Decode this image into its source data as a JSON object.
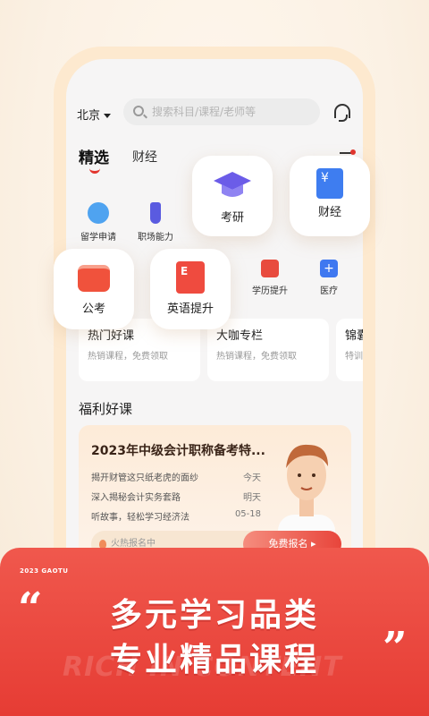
{
  "topbar": {
    "city": "北京",
    "search_placeholder": "搜索科目/课程/老师等"
  },
  "tabs": [
    "精选",
    "财经"
  ],
  "categories_small": [
    {
      "label": "留学申请",
      "icon": "chat-bubble-icon",
      "color": "#4fa3f0"
    },
    {
      "label": "职场能力",
      "icon": "tie-icon",
      "color": "#5a5be0"
    },
    {
      "label": "学历提升",
      "icon": "arrow-up-icon",
      "color": "#e84b3e"
    },
    {
      "label": "医疗",
      "icon": "medical-cross-icon",
      "color": "#3f78f0"
    }
  ],
  "bubbles": [
    {
      "label": "考研",
      "icon": "graduation-cap-icon",
      "color": "#6b5ce8"
    },
    {
      "label": "财经",
      "icon": "yen-book-icon",
      "color": "#3e7df0"
    },
    {
      "label": "公考",
      "icon": "briefcase-icon",
      "color": "#f0523c"
    },
    {
      "label": "英语提升",
      "icon": "english-book-icon",
      "color": "#ef4b3f"
    }
  ],
  "cards": [
    {
      "title": "热门好课",
      "subtitle": "热销课程，免费领取"
    },
    {
      "title": "大咖专栏",
      "subtitle": "热销课程，免费领取"
    },
    {
      "title": "锦囊",
      "subtitle": "特训"
    }
  ],
  "section_title": "福利好课",
  "course": {
    "title": "2023年中级会计职称备考特...",
    "lessons": [
      {
        "name": "揭开财管这只纸老虎的面纱",
        "date": "今天"
      },
      {
        "name": "深入揭秘会计实务套路",
        "date": "明天"
      },
      {
        "name": "听故事，轻松学习经济法",
        "date": "05-18"
      }
    ],
    "hot_text": "火热报名中",
    "signup_label": "免费报名 ▸"
  },
  "banner": {
    "year_text": "2023 GAOTU",
    "open_quote": "“",
    "close_quote": "”",
    "line1": "多元学习品类",
    "line2": "专业精品课程",
    "watermark": "RICH IN CONTENT"
  }
}
